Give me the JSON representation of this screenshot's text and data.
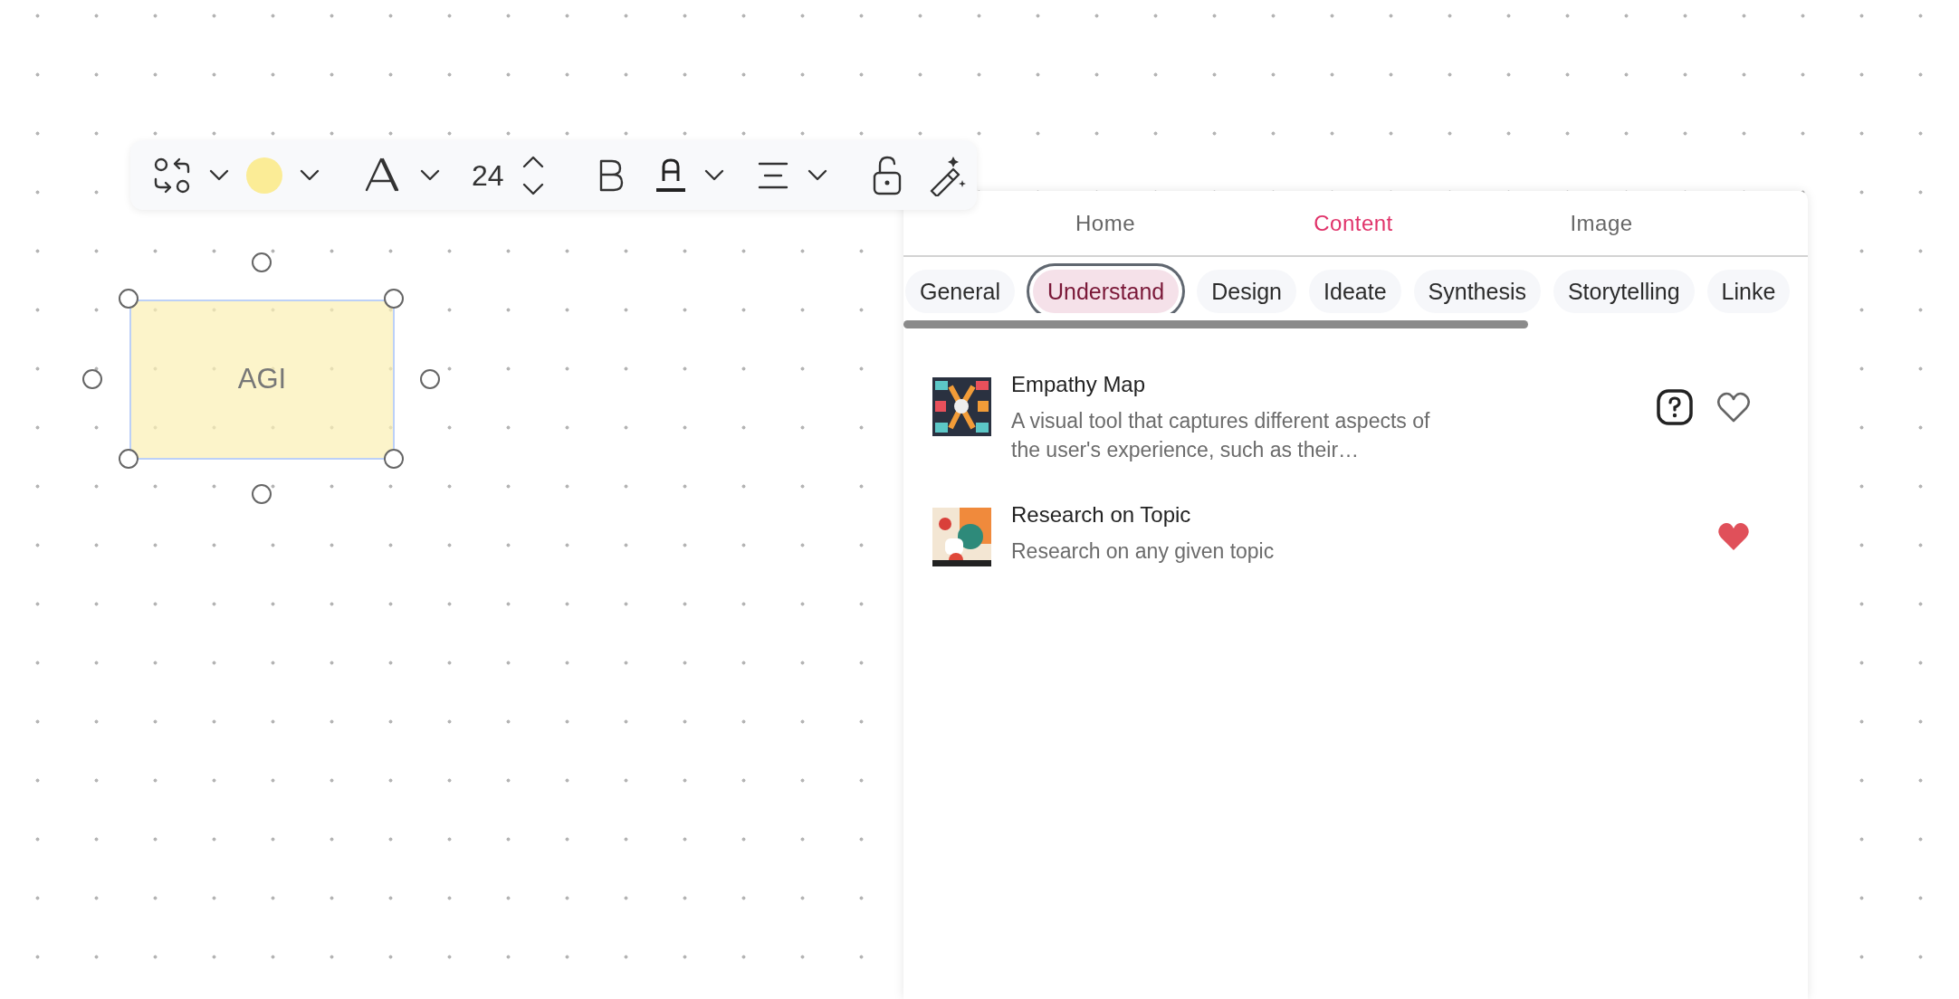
{
  "toolbar": {
    "font_size": "24"
  },
  "shape": {
    "label": "AGI",
    "selected": true
  },
  "panel": {
    "tabs": [
      {
        "label": "Home",
        "selected": false
      },
      {
        "label": "Content",
        "selected": true
      },
      {
        "label": "Image",
        "selected": false
      }
    ],
    "categories": [
      {
        "label": "General",
        "selected": false
      },
      {
        "label": "Understand",
        "selected": true
      },
      {
        "label": "Design",
        "selected": false
      },
      {
        "label": "Ideate",
        "selected": false
      },
      {
        "label": "Synthesis",
        "selected": false
      },
      {
        "label": "Storytelling",
        "selected": false
      },
      {
        "label": "Linke",
        "selected": false
      }
    ],
    "templates": [
      {
        "title": "Empathy Map",
        "description": "A visual tool that captures different aspects of the user's experience, such as their…",
        "has_help": true,
        "favorite": false
      },
      {
        "title": "Research on Topic",
        "description": "Research on any given topic",
        "has_help": false,
        "favorite": true
      }
    ]
  }
}
